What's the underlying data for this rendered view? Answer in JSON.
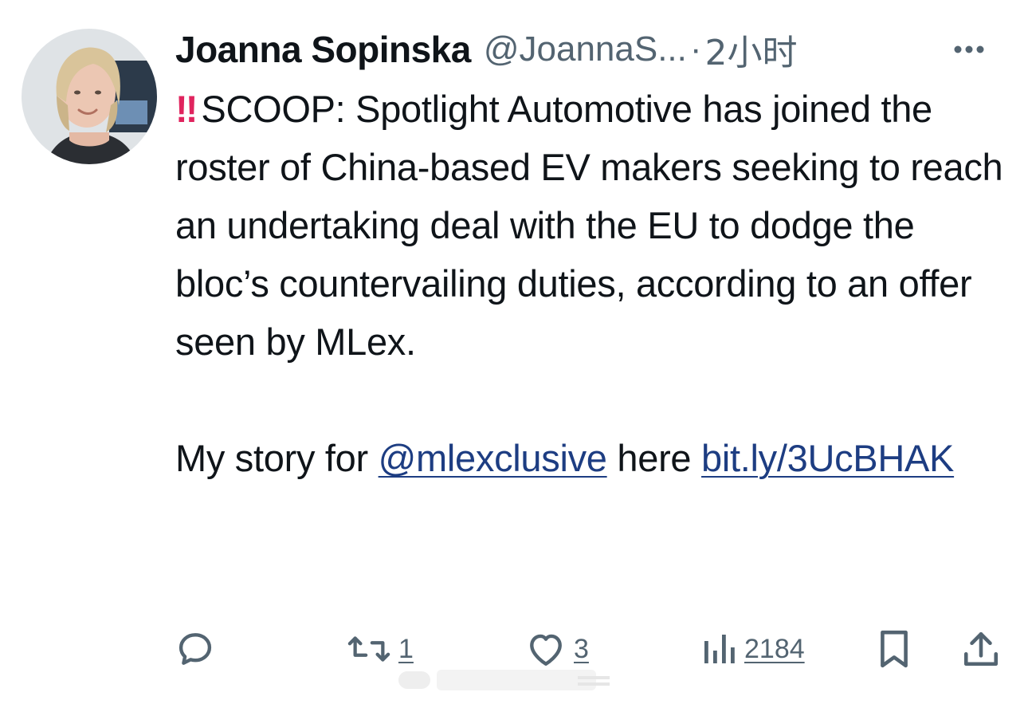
{
  "author": {
    "display_name": "Joanna Sopinska",
    "handle": "@JoannaS...",
    "separator": "·",
    "time": "2小时"
  },
  "tweet": {
    "alert_emoji": "‼",
    "line1": "SCOOP: Spotlight Automotive has",
    "paragraph1_rest": "joined the roster of China-based EV makers seeking to reach an undertaking deal with the EU to dodge the bloc’s countervailing duties, according to an offer seen by MLex.",
    "p2_prefix": "My story for ",
    "mention": "@mlexclusive",
    "p2_middle": " here ",
    "link": "bit.ly/​3UcBHAK"
  },
  "actions": {
    "reply_count": "",
    "retweet_count": "1",
    "like_count": "3",
    "views_count": "2184"
  },
  "icons": {
    "more": "more-horizontal-icon",
    "reply": "reply-icon",
    "retweet": "retweet-icon",
    "like": "heart-icon",
    "views": "views-chart-icon",
    "bookmark": "bookmark-icon",
    "share": "share-icon"
  },
  "colors": {
    "text": "#0f1419",
    "secondary": "#536471",
    "link": "#1d3d82",
    "alert": "#e0245e"
  }
}
